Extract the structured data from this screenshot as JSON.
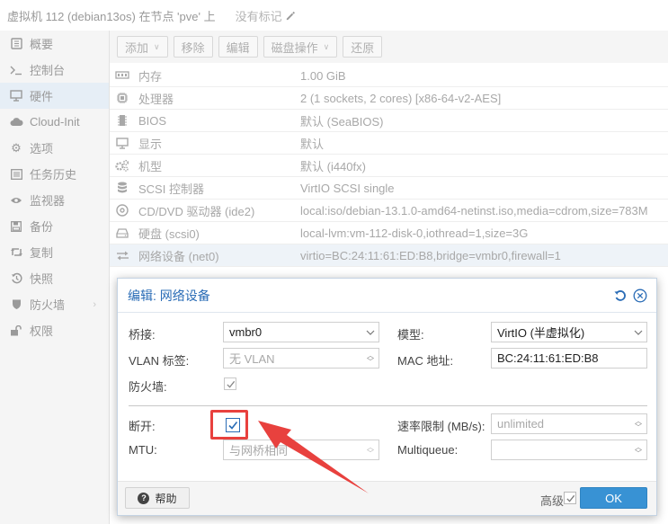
{
  "header": {
    "title": "虚拟机 112 (debian13os) 在节点 'pve' 上",
    "tag_label": "没有标记"
  },
  "nav": {
    "items": [
      {
        "label": "概要",
        "icon": "book-icon"
      },
      {
        "label": "控制台",
        "icon": "terminal-icon"
      },
      {
        "label": "硬件",
        "icon": "monitor-icon"
      },
      {
        "label": "Cloud-Init",
        "icon": "cloud-icon"
      },
      {
        "label": "选项",
        "icon": "gear-icon"
      },
      {
        "label": "任务历史",
        "icon": "list-icon"
      },
      {
        "label": "监视器",
        "icon": "eye-icon"
      },
      {
        "label": "备份",
        "icon": "floppy-icon"
      },
      {
        "label": "复制",
        "icon": "retweet-icon"
      },
      {
        "label": "快照",
        "icon": "history-icon"
      },
      {
        "label": "防火墙",
        "icon": "shield-icon"
      },
      {
        "label": "权限",
        "icon": "unlock-icon"
      }
    ]
  },
  "toolbar": {
    "add": "添加",
    "remove": "移除",
    "edit": "编辑",
    "disk_action": "磁盘操作",
    "revert": "还原"
  },
  "hardware": {
    "rows": [
      {
        "name": "内存",
        "value": "1.00 GiB",
        "icon": "memory-icon"
      },
      {
        "name": "处理器",
        "value": "2 (1 sockets, 2 cores) [x86-64-v2-AES]",
        "icon": "cpu-icon"
      },
      {
        "name": "BIOS",
        "value": "默认 (SeaBIOS)",
        "icon": "microchip-icon"
      },
      {
        "name": "显示",
        "value": "默认",
        "icon": "desktop-icon"
      },
      {
        "name": "机型",
        "value": "默认 (i440fx)",
        "icon": "cogs-icon"
      },
      {
        "name": "SCSI 控制器",
        "value": "VirtIO SCSI single",
        "icon": "database-icon"
      },
      {
        "name": "CD/DVD 驱动器 (ide2)",
        "value": "local:iso/debian-13.1.0-amd64-netinst.iso,media=cdrom,size=783M",
        "icon": "cdrom-icon"
      },
      {
        "name": "硬盘 (scsi0)",
        "value": "local-lvm:vm-112-disk-0,iothread=1,size=3G",
        "icon": "hdd-icon"
      },
      {
        "name": "网络设备 (net0)",
        "value": "virtio=BC:24:11:61:ED:B8,bridge=vmbr0,firewall=1",
        "icon": "exchange-icon"
      }
    ]
  },
  "dialog": {
    "title": "编辑: 网络设备",
    "bridge_label": "桥接:",
    "bridge_value": "vmbr0",
    "vlan_label": "VLAN 标签:",
    "vlan_placeholder": "无 VLAN",
    "firewall_label": "防火墙:",
    "model_label": "模型:",
    "model_value": "VirtIO (半虚拟化)",
    "mac_label": "MAC 地址:",
    "mac_value": "BC:24:11:61:ED:B8",
    "disconnect_label": "断开:",
    "mtu_label": "MTU:",
    "mtu_placeholder": "与网桥相同",
    "rate_label": "速率限制 (MB/s):",
    "rate_placeholder": "unlimited",
    "multiqueue_label": "Multiqueue:",
    "help": "帮助",
    "advanced": "高级",
    "ok": "OK"
  },
  "colors": {
    "accent": "#2a6cb6",
    "ok_button": "#3892d4",
    "highlight_red": "#e8413e"
  }
}
